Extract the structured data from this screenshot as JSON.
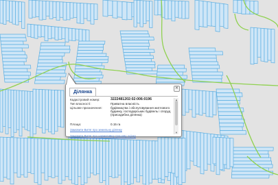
{
  "colors": {
    "background": "#e3e3e3",
    "parcel_fill": "#cfe6f7",
    "parcel_stroke": "#5aaee2",
    "boundary_line": "#8fd14f",
    "link": "#4a7bd0"
  },
  "popup": {
    "tab_label": "Ділянка",
    "close_icon": "close-icon",
    "fields": [
      {
        "label": "Кадастровий номер:",
        "value": "3222481202:02:006:0196"
      },
      {
        "label": "Тип власності:",
        "value": "Приватна власність"
      },
      {
        "label": "Цільове призначення:",
        "value": "будівництва і обслуговування житлового будинку, господарських будівель і споруд (присадибна ділянка)"
      },
      {
        "label": "Площа:",
        "value": "0.15 га"
      }
    ],
    "link1": "Замовити Витяг про земельну ділянку",
    "link2": "Замовити Витяг про нормативну грошову оцінку"
  }
}
